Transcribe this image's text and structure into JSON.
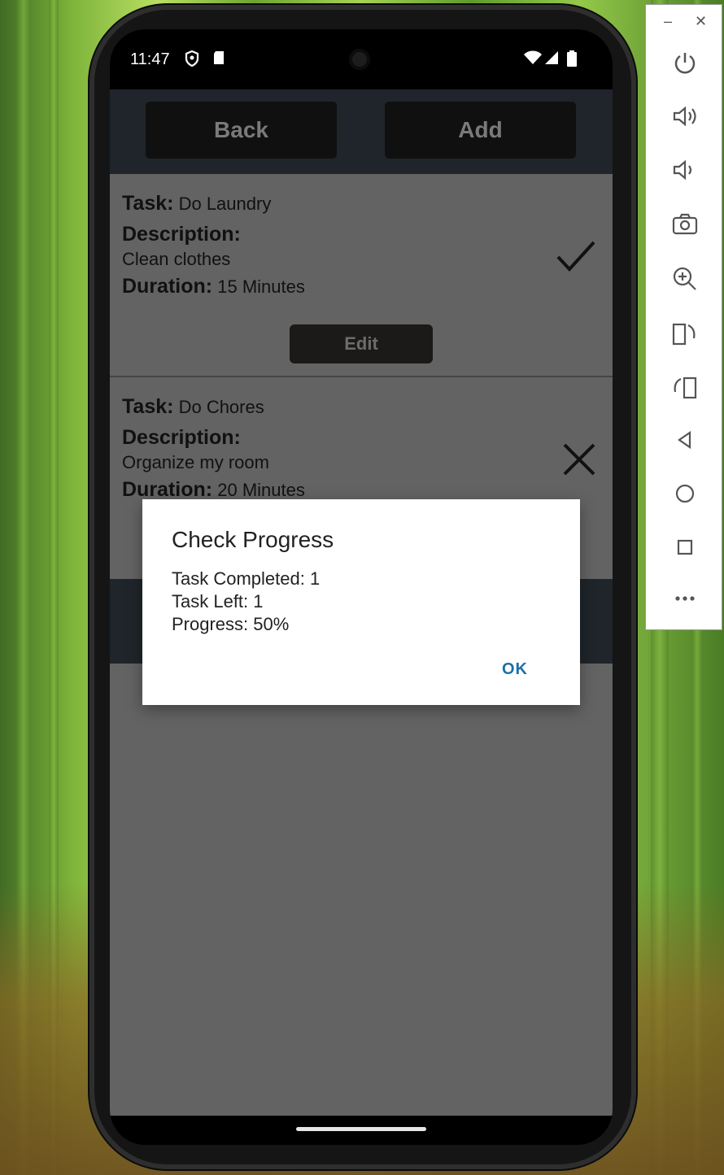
{
  "status_bar": {
    "time": "11:47"
  },
  "top_bar": {
    "back_label": "Back",
    "add_label": "Add"
  },
  "tasks": [
    {
      "task_label": "Task:",
      "task_value": "Do Laundry",
      "description_label": "Description:",
      "description_value": "Clean clothes",
      "duration_label": "Duration:",
      "duration_value": "15 Minutes",
      "status_icon": "check-icon",
      "edit_label": "Edit"
    },
    {
      "task_label": "Task:",
      "task_value": "Do Chores",
      "description_label": "Description:",
      "description_value": "Organize my room",
      "duration_label": "Duration:",
      "duration_value": "20 Minutes",
      "status_icon": "cross-icon"
    }
  ],
  "dialog": {
    "title": "Check Progress",
    "line1": "Task Completed: 1",
    "line2": "Task Left: 1",
    "line3": "Progress: 50%",
    "ok_label": "OK"
  },
  "colors": {
    "app_background": "#636363",
    "top_bar": "#1f252a",
    "button": "#101010",
    "dialog_accent": "#1e6fa8"
  },
  "emulator_panel": {
    "buttons": [
      "power-icon",
      "volume-up-icon",
      "volume-down-icon",
      "camera-icon",
      "zoom-icon",
      "rotate-left-icon",
      "rotate-right-icon",
      "back-icon",
      "home-icon",
      "overview-icon",
      "more-icon"
    ]
  }
}
